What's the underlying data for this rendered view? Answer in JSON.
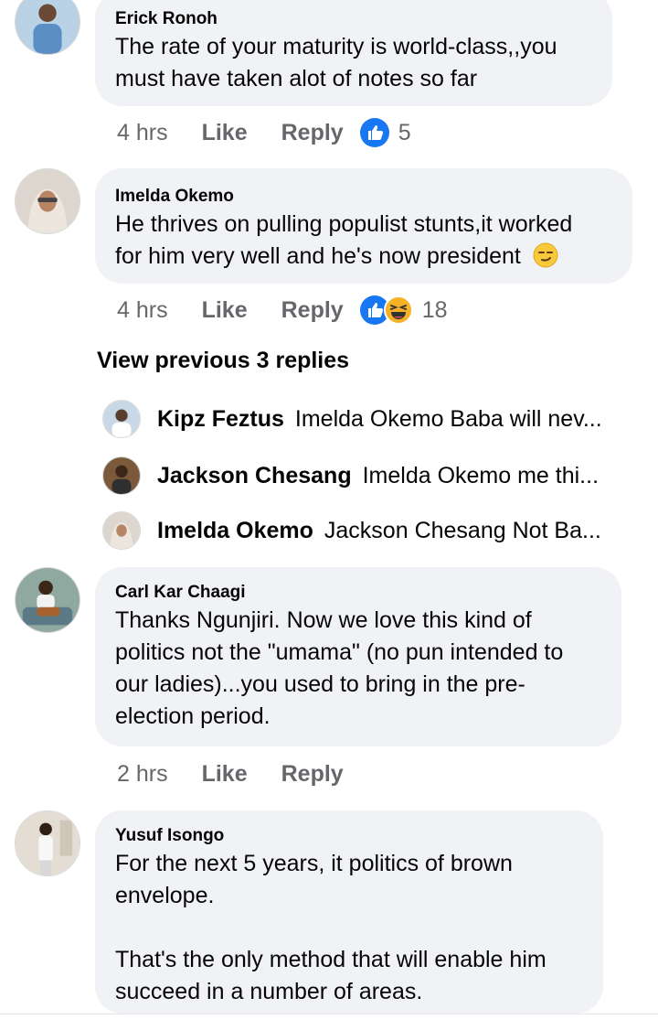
{
  "comments": [
    {
      "author": "Erick Ronoh",
      "lines": [
        "The rate of your maturity is world-class,,you",
        "must have taken alot of notes so far"
      ],
      "time": "4 hrs",
      "like": "Like",
      "reply": "Reply",
      "reactions": [
        "like-icon"
      ],
      "reaction_count": "5"
    },
    {
      "author": "Imelda Okemo",
      "lines": [
        "He thrives on pulling populist stunts,it worked",
        "for him very well and he's now president"
      ],
      "emoji": "smirk-emoji",
      "time": "4 hrs",
      "like": "Like",
      "reply": "Reply",
      "reactions": [
        "like-icon",
        "haha-icon"
      ],
      "reaction_count": "18"
    },
    {
      "author": "Carl Kar Chaagi",
      "lines": [
        "Thanks Ngunjiri. Now we love this kind of",
        "politics not the \"umama\" (no pun intended to",
        "our ladies)...you used to bring in the pre-",
        "election period."
      ],
      "time": "2 hrs",
      "like": "Like",
      "reply": "Reply"
    },
    {
      "author": "Yusuf Isongo",
      "lines": [
        "For the next 5 years, it politics of brown",
        "envelope.",
        "",
        "That's the only method that will enable him",
        "succeed in a number of areas."
      ]
    }
  ],
  "view_previous": "View previous 3 replies",
  "replies": [
    {
      "name": "Kipz Feztus",
      "text": "Imelda Okemo Baba will nev..."
    },
    {
      "name": "Jackson Chesang",
      "text": "Imelda Okemo me thi..."
    },
    {
      "name": "Imelda Okemo",
      "text": "Jackson Chesang Not Ba..."
    }
  ],
  "colors": {
    "bubble": "#f0f2f5",
    "meta_text": "#65676b",
    "like_blue": "#1877f2",
    "haha_yellow": "#f7b125"
  }
}
